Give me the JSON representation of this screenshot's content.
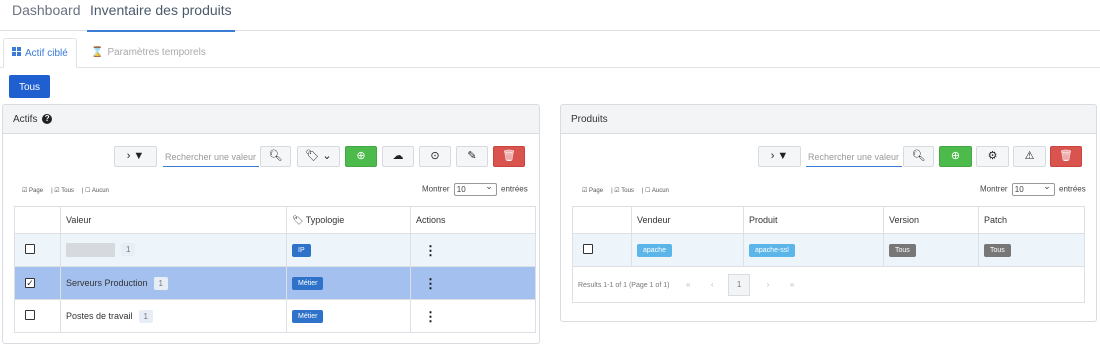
{
  "nav": {
    "tabs": [
      "Dashboard",
      "Inventaire des produits"
    ]
  },
  "subtabs": {
    "actif": "Actif ciblé",
    "temps": "Paramètres temporels"
  },
  "filter_all": "Tous",
  "actifs": {
    "title": "Actifs",
    "search_placeholder": "Rechercher une valeur",
    "selection": {
      "page": "Page",
      "tous": "Tous",
      "aucun": "Aucun"
    },
    "show": {
      "before": "Montrer",
      "value": "10",
      "after": "entrées"
    },
    "columns": {
      "valeur": "Valeur",
      "typologie": "Typologie",
      "actions": "Actions"
    },
    "rows": [
      {
        "valeur": "",
        "count": "1",
        "typologie": "IP",
        "checked": false
      },
      {
        "valeur": "Serveurs Production",
        "count": "1",
        "typologie": "Métier",
        "checked": true
      },
      {
        "valeur": "Postes de travail",
        "count": "1",
        "typologie": "Métier",
        "checked": false
      }
    ]
  },
  "produits": {
    "title": "Produits",
    "search_placeholder": "Rechercher une valeur",
    "selection": {
      "page": "Page",
      "tous": "Tous",
      "aucun": "Aucun"
    },
    "show": {
      "before": "Montrer",
      "value": "10",
      "after": "entrées"
    },
    "columns": {
      "vendeur": "Vendeur",
      "produit": "Produit",
      "version": "Version",
      "patch": "Patch"
    },
    "rows": [
      {
        "vendeur": "apache",
        "produit": "apache-ssl",
        "version": "Tous",
        "patch": "Tous"
      }
    ],
    "pager": {
      "results": "Results 1-1 of 1 (Page 1 of 1)",
      "first": "«",
      "prev": "‹",
      "current": "1",
      "next": "›",
      "last": "»"
    }
  },
  "colors": {
    "accent": "#3a7bd5",
    "primary_btn": "#1f5fcf",
    "green": "#4cbb4c",
    "red": "#d9534f",
    "selected_row": "#a4c0ef"
  }
}
